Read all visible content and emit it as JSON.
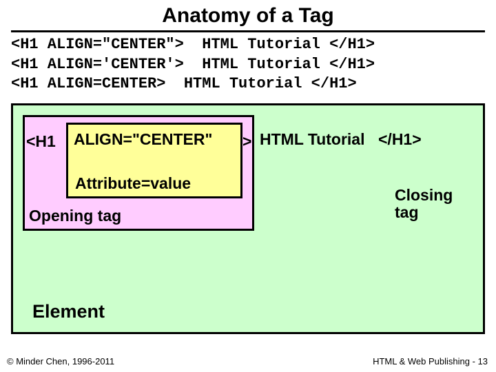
{
  "title": "Anatomy of a Tag",
  "code_examples": [
    "<H1 ALIGN=\"CENTER\">  HTML Tutorial </H1>",
    "<H1 ALIGN='CENTER'>  HTML Tutorial </H1>",
    "<H1 ALIGN=CENTER>  HTML Tutorial </H1>"
  ],
  "diagram": {
    "opening_tag_open": "<H1",
    "attr_value_text": "ALIGN=\"CENTER\"",
    "opening_tag_close": ">",
    "content": "HTML Tutorial",
    "closing_tag": "</H1>",
    "attr_label": "Attribute=value",
    "opening_label": "Opening tag",
    "closing_label_line1": "Closing",
    "closing_label_line2": "tag",
    "element_label": "Element"
  },
  "footer": {
    "left": "© Minder Chen, 1996-2011",
    "right": "HTML & Web Publishing - 13"
  }
}
